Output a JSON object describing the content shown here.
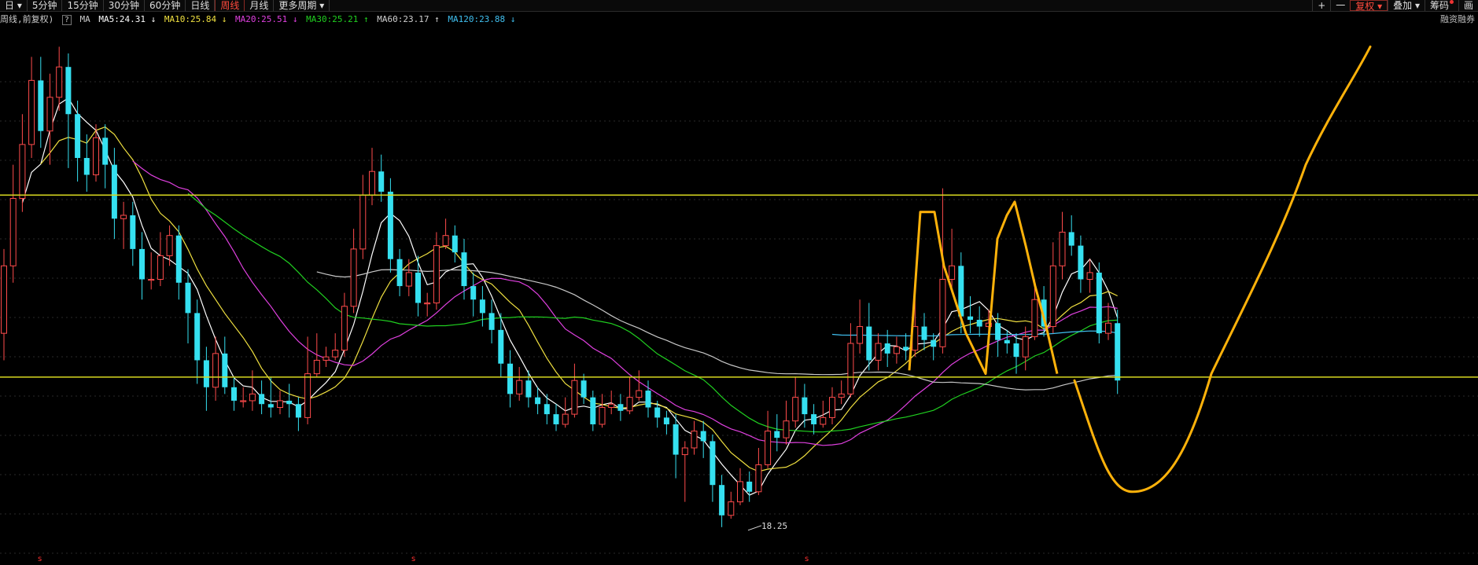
{
  "toolbar": {
    "tabs": [
      "日 ▾",
      "5分钟",
      "15分钟",
      "30分钟",
      "60分钟",
      "日线",
      "周线",
      "月线",
      "更多周期 ▾"
    ],
    "active_tab": "周线",
    "right": {
      "plus": "+",
      "minus": "一",
      "restore": "复权 ▾",
      "overlay": "叠加 ▾",
      "chips": "筹码",
      "draw": "画"
    }
  },
  "indicator": {
    "chart_label": "周线,前复权)",
    "help": "?",
    "ma_label": "MA",
    "ma5": "MA5:24.31 ↓",
    "ma10": "MA10:25.84 ↓",
    "ma20": "MA20:25.51 ↓",
    "ma30": "MA30:25.21 ↑",
    "ma60": "MA60:23.17 ↑",
    "ma120": "MA120:23.88 ↓",
    "right_label": "融资融券"
  },
  "colors": {
    "up": "#ff4b4b",
    "down": "#35e0f0",
    "ma5": "#ffffff",
    "ma10": "#f0e040",
    "ma20": "#e040e0",
    "ma30": "#20d020",
    "ma60": "#c8c8c8",
    "ma120": "#40c0f0",
    "hline": "#d8d820",
    "drawing": "#ffb20a"
  },
  "chart_data": {
    "type": "candlestick",
    "low_marker": "18.25",
    "s_markers": [
      "s",
      "s",
      "s"
    ],
    "ylim": [
      17.5,
      33
    ],
    "horizontal_lines": [
      28.1,
      22.7
    ],
    "candles": [
      [
        24.0,
        26.0,
        26.5,
        23.2
      ],
      [
        26.0,
        28.0,
        29.0,
        25.5
      ],
      [
        28.0,
        29.6,
        30.5,
        27.6
      ],
      [
        29.6,
        31.5,
        32.2,
        29.2
      ],
      [
        31.5,
        30.0,
        32.2,
        29.5
      ],
      [
        30.0,
        31.0,
        31.7,
        29.0
      ],
      [
        31.0,
        31.9,
        32.5,
        30.6
      ],
      [
        31.9,
        30.5,
        32.3,
        28.9
      ],
      [
        30.5,
        29.2,
        30.9,
        28.5
      ],
      [
        29.2,
        28.7,
        29.9,
        28.2
      ],
      [
        28.7,
        29.8,
        30.2,
        28.5
      ],
      [
        29.8,
        29.0,
        30.2,
        28.3
      ],
      [
        29.0,
        27.4,
        29.5,
        26.8
      ],
      [
        27.4,
        27.5,
        27.9,
        26.5
      ],
      [
        27.5,
        26.5,
        27.9,
        26.0
      ],
      [
        26.5,
        25.6,
        27.0,
        25.0
      ],
      [
        25.6,
        25.6,
        26.4,
        25.3
      ],
      [
        25.6,
        26.3,
        27.0,
        25.4
      ],
      [
        26.3,
        26.9,
        27.2,
        26.0
      ],
      [
        26.9,
        25.5,
        27.2,
        25.0
      ],
      [
        25.5,
        24.6,
        25.9,
        23.7
      ],
      [
        24.6,
        23.2,
        25.0,
        22.5
      ],
      [
        23.2,
        22.4,
        23.6,
        21.7
      ],
      [
        22.4,
        23.4,
        23.9,
        22.0
      ],
      [
        23.4,
        22.4,
        23.9,
        22.2
      ],
      [
        22.4,
        22.0,
        22.7,
        21.7
      ],
      [
        22.0,
        22.0,
        22.4,
        21.8
      ],
      [
        22.0,
        22.2,
        22.9,
        21.7
      ],
      [
        22.2,
        21.9,
        22.6,
        21.6
      ],
      [
        21.9,
        21.8,
        22.7,
        21.5
      ],
      [
        21.8,
        22.0,
        22.3,
        21.6
      ],
      [
        22.0,
        21.9,
        22.5,
        21.5
      ],
      [
        21.9,
        21.5,
        22.1,
        21.1
      ],
      [
        21.5,
        22.8,
        23.9,
        21.3
      ],
      [
        22.8,
        23.2,
        24.0,
        22.7
      ],
      [
        23.2,
        23.3,
        23.6,
        23.0
      ],
      [
        23.3,
        23.5,
        24.0,
        23.2
      ],
      [
        23.5,
        24.8,
        25.2,
        23.3
      ],
      [
        24.8,
        26.5,
        27.1,
        24.6
      ],
      [
        26.5,
        28.1,
        28.7,
        26.2
      ],
      [
        28.1,
        28.8,
        29.5,
        27.8
      ],
      [
        28.8,
        28.2,
        29.3,
        27.9
      ],
      [
        28.2,
        26.2,
        28.6,
        25.8
      ],
      [
        26.2,
        25.4,
        26.5,
        25.1
      ],
      [
        25.4,
        25.8,
        26.2,
        25.1
      ],
      [
        25.8,
        24.9,
        26.3,
        24.5
      ],
      [
        24.9,
        24.9,
        25.2,
        24.5
      ],
      [
        24.9,
        26.6,
        27.0,
        24.7
      ],
      [
        26.6,
        26.9,
        27.4,
        26.5
      ],
      [
        26.9,
        26.4,
        27.2,
        26.1
      ],
      [
        26.4,
        25.4,
        26.8,
        25.0
      ],
      [
        25.4,
        25.0,
        25.8,
        24.5
      ],
      [
        25.0,
        24.6,
        25.4,
        24.2
      ],
      [
        24.6,
        24.1,
        25.0,
        23.7
      ],
      [
        24.1,
        23.1,
        24.6,
        22.7
      ],
      [
        23.1,
        22.2,
        23.5,
        21.8
      ],
      [
        22.2,
        22.6,
        23.0,
        22.0
      ],
      [
        22.6,
        22.1,
        22.9,
        21.8
      ],
      [
        22.1,
        21.9,
        22.4,
        21.6
      ],
      [
        21.9,
        21.6,
        22.2,
        21.3
      ],
      [
        21.6,
        21.3,
        21.9,
        21.1
      ],
      [
        21.3,
        21.6,
        22.1,
        21.2
      ],
      [
        21.6,
        22.6,
        23.1,
        21.5
      ],
      [
        22.6,
        22.1,
        22.8,
        21.9
      ],
      [
        22.1,
        21.3,
        22.3,
        21.1
      ],
      [
        21.3,
        21.8,
        22.2,
        21.2
      ],
      [
        21.8,
        21.9,
        22.3,
        21.6
      ],
      [
        21.9,
        21.7,
        22.2,
        21.4
      ],
      [
        21.7,
        22.1,
        22.7,
        21.6
      ],
      [
        22.1,
        22.3,
        22.9,
        22.0
      ],
      [
        22.3,
        21.8,
        22.6,
        21.5
      ],
      [
        21.8,
        21.5,
        22.0,
        21.2
      ],
      [
        21.5,
        21.3,
        21.7,
        21.0
      ],
      [
        21.3,
        20.4,
        21.6,
        19.7
      ],
      [
        20.4,
        20.6,
        20.8,
        19.0
      ],
      [
        20.6,
        21.1,
        21.4,
        20.4
      ],
      [
        21.1,
        20.8,
        21.4,
        20.3
      ],
      [
        20.8,
        19.5,
        21.0,
        19.0
      ],
      [
        19.5,
        18.6,
        19.8,
        18.25
      ],
      [
        18.6,
        19.0,
        19.3,
        18.5
      ],
      [
        19.0,
        19.6,
        20.0,
        18.9
      ],
      [
        19.6,
        19.3,
        19.9,
        19.0
      ],
      [
        19.3,
        20.1,
        20.6,
        19.2
      ],
      [
        20.1,
        21.1,
        21.7,
        20.0
      ],
      [
        21.1,
        20.9,
        21.6,
        20.5
      ],
      [
        20.9,
        21.4,
        22.0,
        20.7
      ],
      [
        21.4,
        22.1,
        22.7,
        21.2
      ],
      [
        22.1,
        21.6,
        22.5,
        21.2
      ],
      [
        21.6,
        21.3,
        21.9,
        21.0
      ],
      [
        21.3,
        21.5,
        22.0,
        21.2
      ],
      [
        21.5,
        22.1,
        22.4,
        21.3
      ],
      [
        22.1,
        22.2,
        22.6,
        21.9
      ],
      [
        22.2,
        23.7,
        24.3,
        22.1
      ],
      [
        23.7,
        24.2,
        25.0,
        23.4
      ],
      [
        24.2,
        23.2,
        24.9,
        22.9
      ],
      [
        23.2,
        23.7,
        24.0,
        22.9
      ],
      [
        23.7,
        23.4,
        24.1,
        23.0
      ],
      [
        23.4,
        23.6,
        23.9,
        23.1
      ],
      [
        23.6,
        23.5,
        24.0,
        23.2
      ],
      [
        23.5,
        24.2,
        25.1,
        23.3
      ],
      [
        24.2,
        23.8,
        24.6,
        23.5
      ],
      [
        23.8,
        23.6,
        24.0,
        23.2
      ],
      [
        23.6,
        25.6,
        28.3,
        23.4
      ],
      [
        25.6,
        26.0,
        27.1,
        25.2
      ],
      [
        26.0,
        24.5,
        26.4,
        24.0
      ],
      [
        24.5,
        24.4,
        25.1,
        24.0
      ],
      [
        24.4,
        24.2,
        24.8,
        23.9
      ],
      [
        24.2,
        24.3,
        24.7,
        23.9
      ],
      [
        24.3,
        23.8,
        24.6,
        23.3
      ],
      [
        23.8,
        23.7,
        24.1,
        23.4
      ],
      [
        23.7,
        23.3,
        24.0,
        22.8
      ],
      [
        23.3,
        23.9,
        24.2,
        22.9
      ],
      [
        23.9,
        25.0,
        25.6,
        23.8
      ],
      [
        25.0,
        24.2,
        25.4,
        23.9
      ],
      [
        24.2,
        26.0,
        26.7,
        24.0
      ],
      [
        26.0,
        27.0,
        27.6,
        25.6
      ],
      [
        27.0,
        26.6,
        27.5,
        26.3
      ],
      [
        26.6,
        25.6,
        26.9,
        25.2
      ],
      [
        25.6,
        25.8,
        26.2,
        25.2
      ],
      [
        25.8,
        24.0,
        26.1,
        23.7
      ],
      [
        24.0,
        24.3,
        24.9,
        23.8
      ],
      [
        24.3,
        22.6,
        24.7,
        22.2
      ]
    ]
  }
}
